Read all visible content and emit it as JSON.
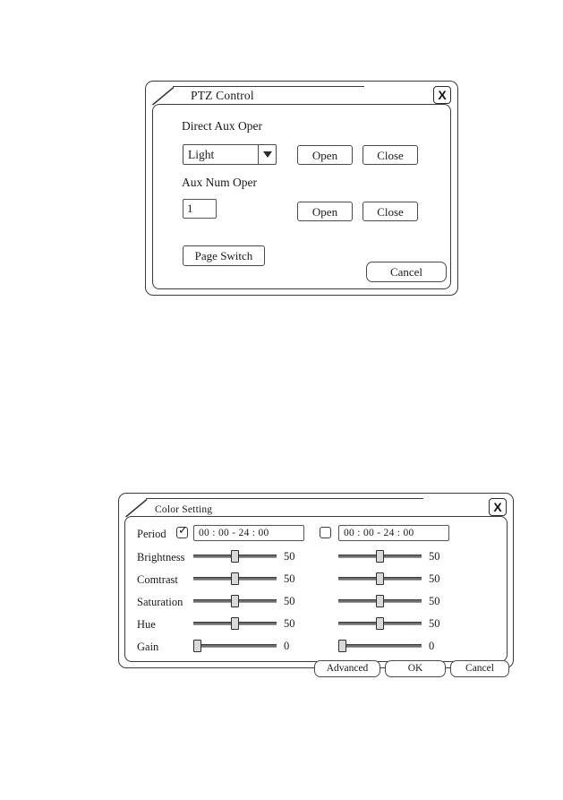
{
  "ptz_dialog": {
    "title": "PTZ Control",
    "close_label": "X",
    "section_direct": {
      "label": "Direct Aux Oper",
      "select_value": "Light",
      "select_options": [
        "Light"
      ],
      "open_label": "Open",
      "close_label": "Close"
    },
    "section_aux_num": {
      "label": "Aux Num Oper",
      "input_value": "1",
      "open_label": "Open",
      "close_label": "Close"
    },
    "page_switch_label": "Page Switch",
    "cancel_label": "Cancel"
  },
  "color_dialog": {
    "title": "Color Setting",
    "close_label": "X",
    "period_label": "Period",
    "columns": [
      {
        "enabled": true,
        "checkbox_mark": "✓",
        "time_range": "00 : 00     -     24 : 00",
        "values": {
          "brightness": "50",
          "contrast": "50",
          "saturation": "50",
          "hue": "50",
          "gain": "0"
        },
        "positions": {
          "brightness": 50,
          "contrast": 50,
          "saturation": 50,
          "hue": 50,
          "gain": 0
        }
      },
      {
        "enabled": false,
        "checkbox_mark": "",
        "time_range": "00 : 00     -     24 : 00",
        "values": {
          "brightness": "50",
          "contrast": "50",
          "saturation": "50",
          "hue": "50",
          "gain": "0"
        },
        "positions": {
          "brightness": 50,
          "contrast": 50,
          "saturation": 50,
          "hue": 50,
          "gain": 0
        }
      }
    ],
    "rows": [
      {
        "key": "brightness",
        "label": "Brightness"
      },
      {
        "key": "contrast",
        "label": "Comtrast"
      },
      {
        "key": "saturation",
        "label": "Saturation"
      },
      {
        "key": "hue",
        "label": "Hue"
      },
      {
        "key": "gain",
        "label": "Gain"
      }
    ],
    "advanced_label": "Advanced",
    "ok_label": "OK",
    "cancel_label": "Cancel"
  }
}
